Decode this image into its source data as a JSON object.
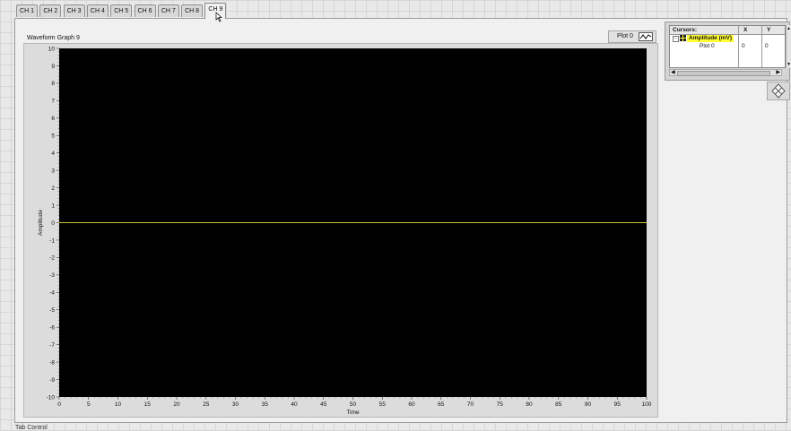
{
  "tabs": [
    "CH 1",
    "CH 2",
    "CH 3",
    "CH 4",
    "CH 5",
    "CH 6",
    "CH 7",
    "CH 8",
    "CH 9"
  ],
  "active_tab_index": 8,
  "graph": {
    "label": "Waveform Graph 9",
    "legend_label": "Plot 0"
  },
  "cursors": {
    "title": "Cursors:",
    "col_x": "X",
    "col_y": "Y",
    "cursor_name": "Amplitude (mV)",
    "row_plot": "Plot 0",
    "x_value": "0",
    "y_value": "0"
  },
  "tab_control_label": "Tab Control",
  "colors": {
    "plot_bg": "#000000",
    "trace": "#c8c83a",
    "cursor_highlight": "#ffff33"
  },
  "chart_data": {
    "type": "line",
    "xlabel": "Time",
    "ylabel": "Amplitude",
    "xlim": [
      0,
      100
    ],
    "ylim": [
      -10,
      10
    ],
    "xticks": [
      0,
      5,
      10,
      15,
      20,
      25,
      30,
      35,
      40,
      45,
      50,
      55,
      60,
      65,
      70,
      75,
      80,
      85,
      90,
      95,
      100
    ],
    "yticks": [
      10,
      9,
      8,
      7,
      6,
      5,
      4,
      3,
      2,
      1,
      0,
      -1,
      -2,
      -3,
      -4,
      -5,
      -6,
      -7,
      -8,
      -9,
      -10
    ],
    "series": [
      {
        "x": [
          0,
          100
        ],
        "y": [
          0,
          0
        ]
      }
    ],
    "grid": false
  }
}
